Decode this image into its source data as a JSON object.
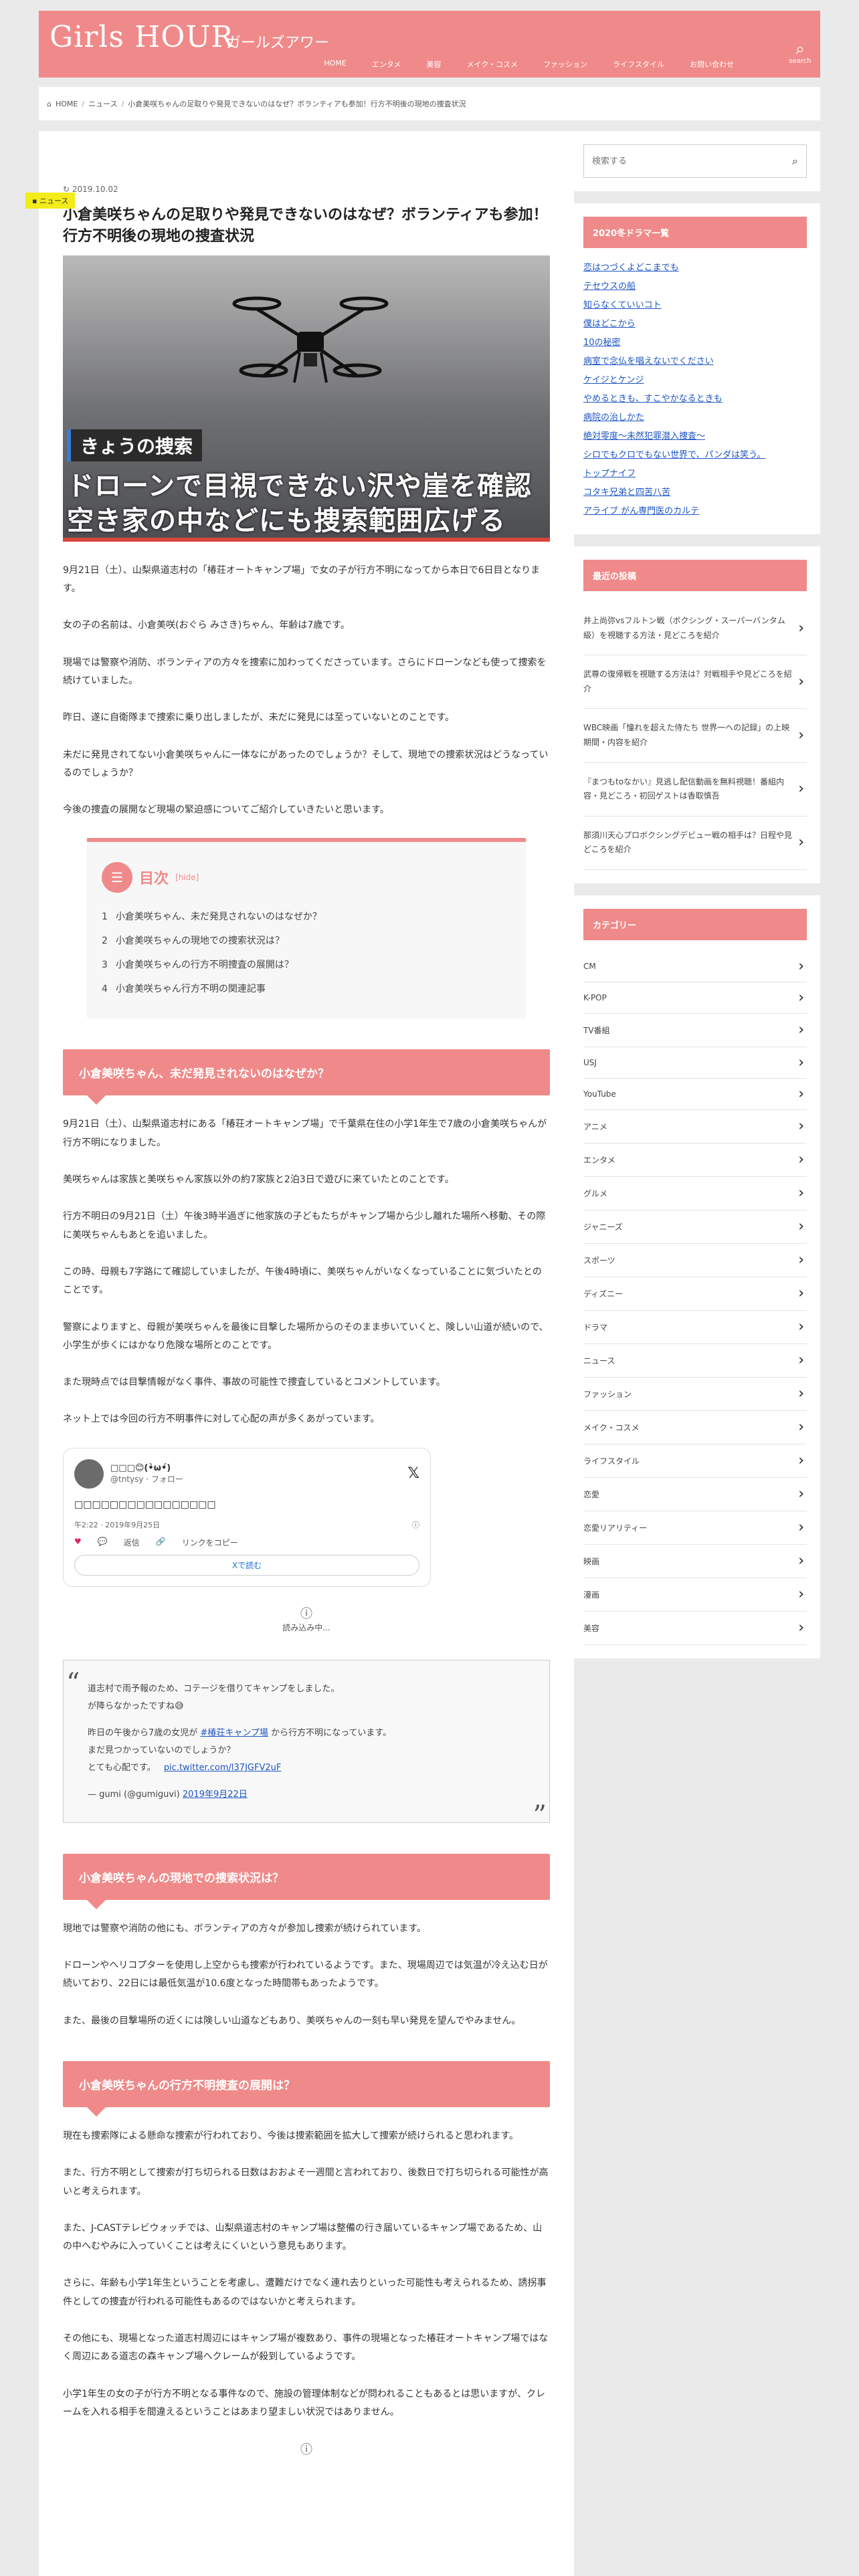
{
  "header": {
    "logo": "Girls HOUR",
    "logo_sub": "ガールズアワー",
    "nav": [
      "HOME",
      "エンタメ",
      "美容",
      "メイク・コスメ",
      "ファッション",
      "ライフスタイル",
      "お問い合わせ"
    ],
    "search_label": "search"
  },
  "breadcrumb": [
    "HOME",
    "ニュース",
    "小倉美咲ちゃんの足取りや発見できないのはなぜ？ボランティアも参加！行方不明後の現地の捜査状況"
  ],
  "article": {
    "category": "ニュース",
    "date": "2019.10.02",
    "title": "小倉美咲ちゃんの足取りや発見できないのはなぜ？ボランティアも参加！行方不明後の現地の捜査状況",
    "hero": {
      "label": "きょうの捜索",
      "line1": "ドローンで目視できない沢や崖を確認",
      "line2": "空き家の中などにも捜索範囲広げる"
    },
    "intro": [
      "9月21日（土）、山梨県道志村の「椿荘オートキャンプ場」で女の子が行方不明になってから本日で6日目となります。",
      "女の子の名前は、小倉美咲(おぐら みさき)ちゃん、年齢は7歳です。",
      "現場では警察や消防、ボランティアの方々を捜索に加わってくださっています。さらにドローンなども使って捜索を続けていました。",
      "昨日、遂に自衛隊まで捜索に乗り出しましたが、未だに発見には至っていないとのことです。",
      "未だに発見されてない小倉美咲ちゃんに一体なにがあったのでしょうか？そして、現地での捜索状況はどうなっているのでしょうか？",
      "今後の捜査の展開など現場の緊迫感についてご紹介していきたいと思います。"
    ],
    "toc": {
      "title": "目次",
      "hide": "[hide]",
      "items": [
        "小倉美咲ちゃん、未だ発見されないのはなぜか？",
        "小倉美咲ちゃんの現地での捜索状況は？",
        "小倉美咲ちゃんの行方不明捜査の展開は？",
        "小倉美咲ちゃん行方不明の関連記事"
      ]
    },
    "section1": {
      "heading": "小倉美咲ちゃん、未だ発見されないのはなぜか？",
      "paras": [
        "9月21日（土）、山梨県道志村にある「椿荘オートキャンプ場」で千葉県在住の小学1年生で7歳の小倉美咲ちゃんが行方不明になりました。",
        "美咲ちゃんは家族と美咲ちゃん家族以外の約7家族と2泊3日で遊びに来ていたとのことです。",
        "行方不明日の9月21日（土）午後3時半過ぎに他家族の子どもたちがキャンプ場から少し離れた場所へ移動、その際に美咲ちゃんもあとを追いました。",
        "この時、母親も7字路にて確認していましたが、午後4時頃に、美咲ちゃんがいなくなっていることに気づいたとのことです。",
        "警察によりますと、母親が美咲ちゃんを最後に目撃した場所からのそのまま歩いていくと、険しい山道が続いので、小学生が歩くにはかなり危険な場所とのことです。",
        "また現時点では目撃情報がなく事件、事故の可能性で捜査しているとコメントしています。",
        "ネット上では今回の行方不明事件に対して心配の声が多くあがっています。"
      ]
    },
    "tweet": {
      "name": "□□□😊(•̀ω•́)",
      "handle": "@tntysy · フォロー",
      "body": "□□□□□□□□□□□□□□□□",
      "time": "午2:22 · 2019年9月25日",
      "likes": "",
      "reply": "返信",
      "copy": "リンクをコピー",
      "button": "Xで読む",
      "loading": "読み込み中..."
    },
    "quote": {
      "lines": [
        "道志村で雨予報のため、コテージを借りてキャンプをしました。",
        "が降らなかったですね😅",
        "",
        "昨日の午後から7歳の女児が",
        "から行方不明になっています。",
        "まだ見つかっていないのでしょうか？",
        "とても心配です。"
      ],
      "hashtag": "#椿荘キャンプ場",
      "pic": "pic.twitter.com/l37JGFV2uF",
      "author": "— gumi (@gumiguvi)",
      "date": "2019年9月22日"
    },
    "section2": {
      "heading": "小倉美咲ちゃんの現地での捜索状況は？",
      "paras": [
        "現地では警察や消防の他にも、ボランティアの方々が参加し捜索が続けられています。",
        "ドローンやヘリコプターを使用し上空からも捜索が行われているようです。また、現場周辺では気温が冷え込む日が続いており、22日には最低気温が10.6度となった時間帯もあったようです。",
        "また、最後の目撃場所の近くには険しい山道などもあり、美咲ちゃんの一刻も早い発見を望んでやみません。"
      ]
    },
    "section3": {
      "heading": "小倉美咲ちゃんの行方不明捜査の展開は？",
      "paras": [
        "現在も捜索隊による懸命な捜索が行われており、今後は捜索範囲を拡大して捜索が続けられると思われます。",
        "また、行方不明として捜索が打ち切られる日数はおおよそ一週間と言われており、後数日で打ち切られる可能性が高いと考えられます。",
        "また、J-CASTテレビウォッチでは、山梨県道志村のキャンプ場は整備の行き届いているキャンプ場であるため、山の中へむやみに入っていくことは考えにくいという意見もあります。",
        "さらに、年齢も小学1年生ということを考慮し、遭難だけでなく連れ去りといった可能性も考えられるため、誘拐事件としての捜査が行われる可能性もあるのではないかと考えられます。",
        "その他にも、現場となった道志村周辺にはキャンプ場が複数あり、事件の現場となった椿荘オートキャンプ場ではなく周辺にある道志の森キャンプ場へクレームが殺到しているようです。",
        "小学1年生の女の子が行方不明となる事件なので、施設の管理体制などが問われることもあるとは思いますが、クレームを入れる相手を間違えるということはあまり望ましい状況ではありません。"
      ]
    }
  },
  "sidebar": {
    "search_placeholder": "検索する",
    "drama_title": "2020冬ドラマ一覧",
    "dramas": [
      "恋はつづくよどこまでも",
      "テセウスの船",
      "知らなくていいコト",
      "僕はどこから",
      "10の秘密",
      "病室で念仏を唱えないでください",
      "ケイジとケンジ",
      "やめるときも、すこやかなるときも",
      "病院の治しかた",
      "絶対零度〜未然犯罪潜入捜査〜",
      "シロでもクロでもない世界で、パンダは笑う。",
      "トップナイフ",
      "コタキ兄弟と四苦八苦",
      "アライブ がん専門医のカルテ"
    ],
    "recent_title": "最近の投稿",
    "recent": [
      "井上尚弥vsフルトン戦（ボクシング・スーパーバンタム級）を視聴する方法・見どころを紹介",
      "武尊の復帰戦を視聴する方法は？対戦相手や見どころを紹介",
      "WBC映画「憧れを超えた侍たち 世界一への記録」の上映期間・内容を紹介",
      "『まつもtoなかい』見逃し配信動画を無料視聴！番組内容・見どころ・初回ゲストは香取慎吾",
      "那須川天心プロボクシングデビュー戦の相手は？日程や見どころを紹介"
    ],
    "category_title": "カテゴリー",
    "categories": [
      "CM",
      "K-POP",
      "TV番組",
      "USJ",
      "YouTube",
      "アニメ",
      "エンタメ",
      "グルメ",
      "ジャニーズ",
      "スポーツ",
      "ディズニー",
      "ドラマ",
      "ニュース",
      "ファッション",
      "メイク・コスメ",
      "ライフスタイル",
      "恋愛",
      "恋愛リアリティー",
      "映画",
      "漫画",
      "美容"
    ]
  },
  "colors": {
    "brand": "#f08a8a",
    "tag": "#f4ec1a",
    "link": "#1d55c4"
  }
}
